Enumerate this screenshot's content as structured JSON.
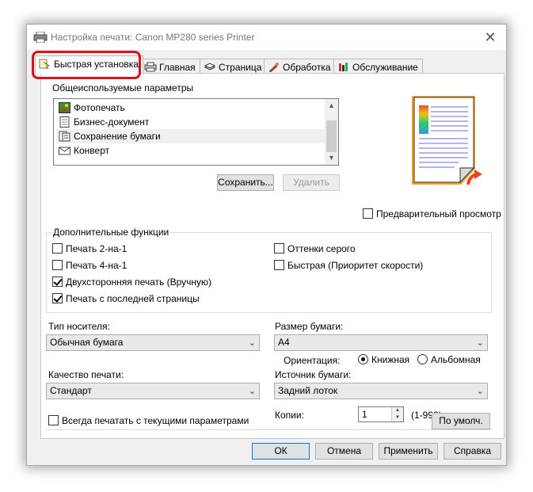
{
  "window": {
    "title": "Настройка печати: Canon MP280 series Printer"
  },
  "tabs": [
    {
      "label": "Быстрая установка",
      "icon": "quick-setup-icon"
    },
    {
      "label": "Главная",
      "icon": "main-icon"
    },
    {
      "label": "Страница",
      "icon": "page-setup-icon"
    },
    {
      "label": "Обработка",
      "icon": "effects-icon"
    },
    {
      "label": "Обслуживание",
      "icon": "maintenance-icon"
    }
  ],
  "common_settings": {
    "title": "Общеиспользуемые параметры",
    "items": [
      {
        "label": "Фотопечать",
        "icon": "photo-icon"
      },
      {
        "label": "Бизнес-документ",
        "icon": "document-icon"
      },
      {
        "label": "Сохранение бумаги",
        "icon": "paper-save-icon"
      },
      {
        "label": "Конверт",
        "icon": "envelope-icon"
      }
    ],
    "selected_index": 2,
    "save_label": "Сохранить...",
    "delete_label": "Удалить"
  },
  "preview": {
    "label": "Предварительный просмотр",
    "checked": false
  },
  "additional": {
    "title": "Дополнительные функции",
    "options": [
      {
        "label": "Печать 2-на-1",
        "checked": false
      },
      {
        "label": "Печать 4-на-1",
        "checked": false
      },
      {
        "label": "Двухсторонняя печать (Вручную)",
        "checked": true
      },
      {
        "label": "Печать с последней страницы",
        "checked": true
      },
      {
        "label": "Оттенки серого",
        "checked": false
      },
      {
        "label": "Быстрая (Приоритет скорости)",
        "checked": false
      }
    ]
  },
  "media_type": {
    "label": "Тип носителя:",
    "value": "Обычная бумага"
  },
  "paper_size": {
    "label": "Размер бумаги:",
    "value": "A4"
  },
  "orientation": {
    "label": "Ориентация:",
    "portrait": "Книжная",
    "landscape": "Альбомная",
    "selected": "portrait"
  },
  "print_quality": {
    "label": "Качество печати:",
    "value": "Стандарт"
  },
  "paper_source": {
    "label": "Источник бумаги:",
    "value": "Задний лоток"
  },
  "copies": {
    "label": "Копии:",
    "value": "1",
    "range": "(1-999)"
  },
  "always_print": {
    "label": "Всегда печатать с текущими параметрами",
    "checked": false
  },
  "defaults_label": "По умолч.",
  "footer": {
    "ok": "ОК",
    "cancel": "Отмена",
    "apply": "Применить",
    "help": "Справка"
  },
  "colors": {
    "highlight": "#d5141b",
    "dialog_bg": "#f0f0f0",
    "panel_bg": "#ffffff"
  }
}
